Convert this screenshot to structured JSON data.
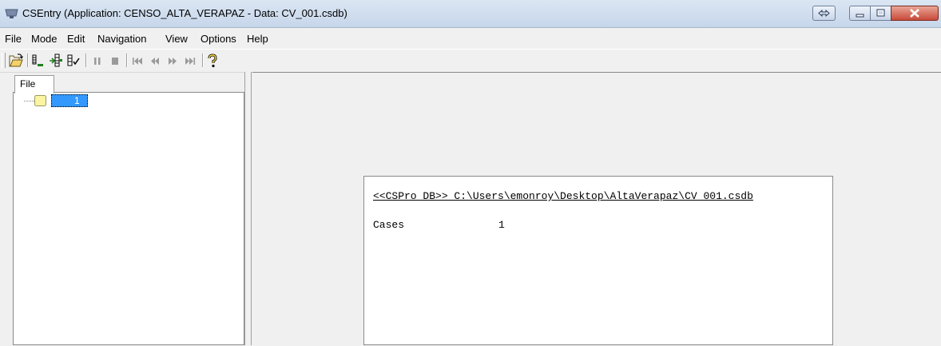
{
  "window": {
    "title": "CSEntry (Application: CENSO_ALTA_VERAPAZ - Data: CV_001.csdb)",
    "title_bar_color": "#c6d6ea",
    "close_button_color": "#c94a3a"
  },
  "menu": {
    "items": [
      "File",
      "Mode",
      "Edit",
      "Navigation",
      "View",
      "Options",
      "Help"
    ]
  },
  "toolbar": {
    "buttons": [
      {
        "icon": "open-folder-icon"
      },
      {
        "icon": "add-case-icon"
      },
      {
        "icon": "insert-case-icon"
      },
      {
        "icon": "verify-case-icon"
      },
      {
        "icon": "pause-icon"
      },
      {
        "icon": "stop-icon"
      },
      {
        "icon": "first-icon"
      },
      {
        "icon": "previous-icon"
      },
      {
        "icon": "next-icon"
      },
      {
        "icon": "last-icon"
      },
      {
        "icon": "help-icon"
      }
    ]
  },
  "left_pane": {
    "tab_label": "File",
    "tree": [
      {
        "label": "1",
        "selected": true,
        "selection_color": "#3399ff"
      }
    ]
  },
  "info": {
    "header": "<<CSPro DB>> C:\\Users\\emonroy\\Desktop\\AltaVerapaz\\CV_001.csdb",
    "cases_label": "Cases",
    "cases_value": "1"
  }
}
